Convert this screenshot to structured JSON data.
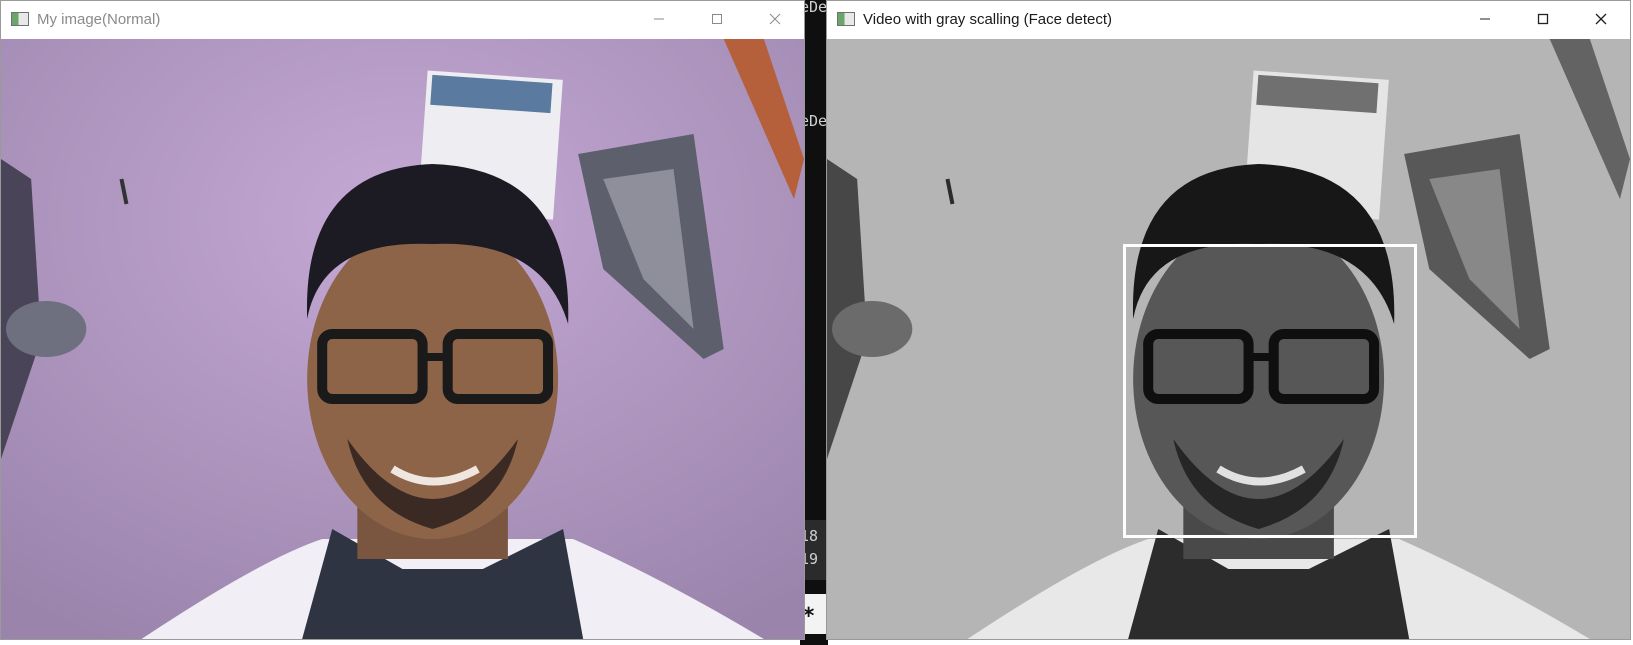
{
  "windows": {
    "left": {
      "title": "My image(Normal)",
      "icon": "opencv-window-icon",
      "controls": [
        "minimize",
        "maximize",
        "close"
      ]
    },
    "right": {
      "title": "Video with gray scalling (Face detect)",
      "icon": "opencv-window-icon",
      "controls": [
        "minimize",
        "maximize",
        "close"
      ],
      "detection_box_color": "#ffffff"
    }
  },
  "background_editor": {
    "fragments": [
      "eDe",
      "eDe",
      "18",
      "19",
      "*"
    ]
  }
}
